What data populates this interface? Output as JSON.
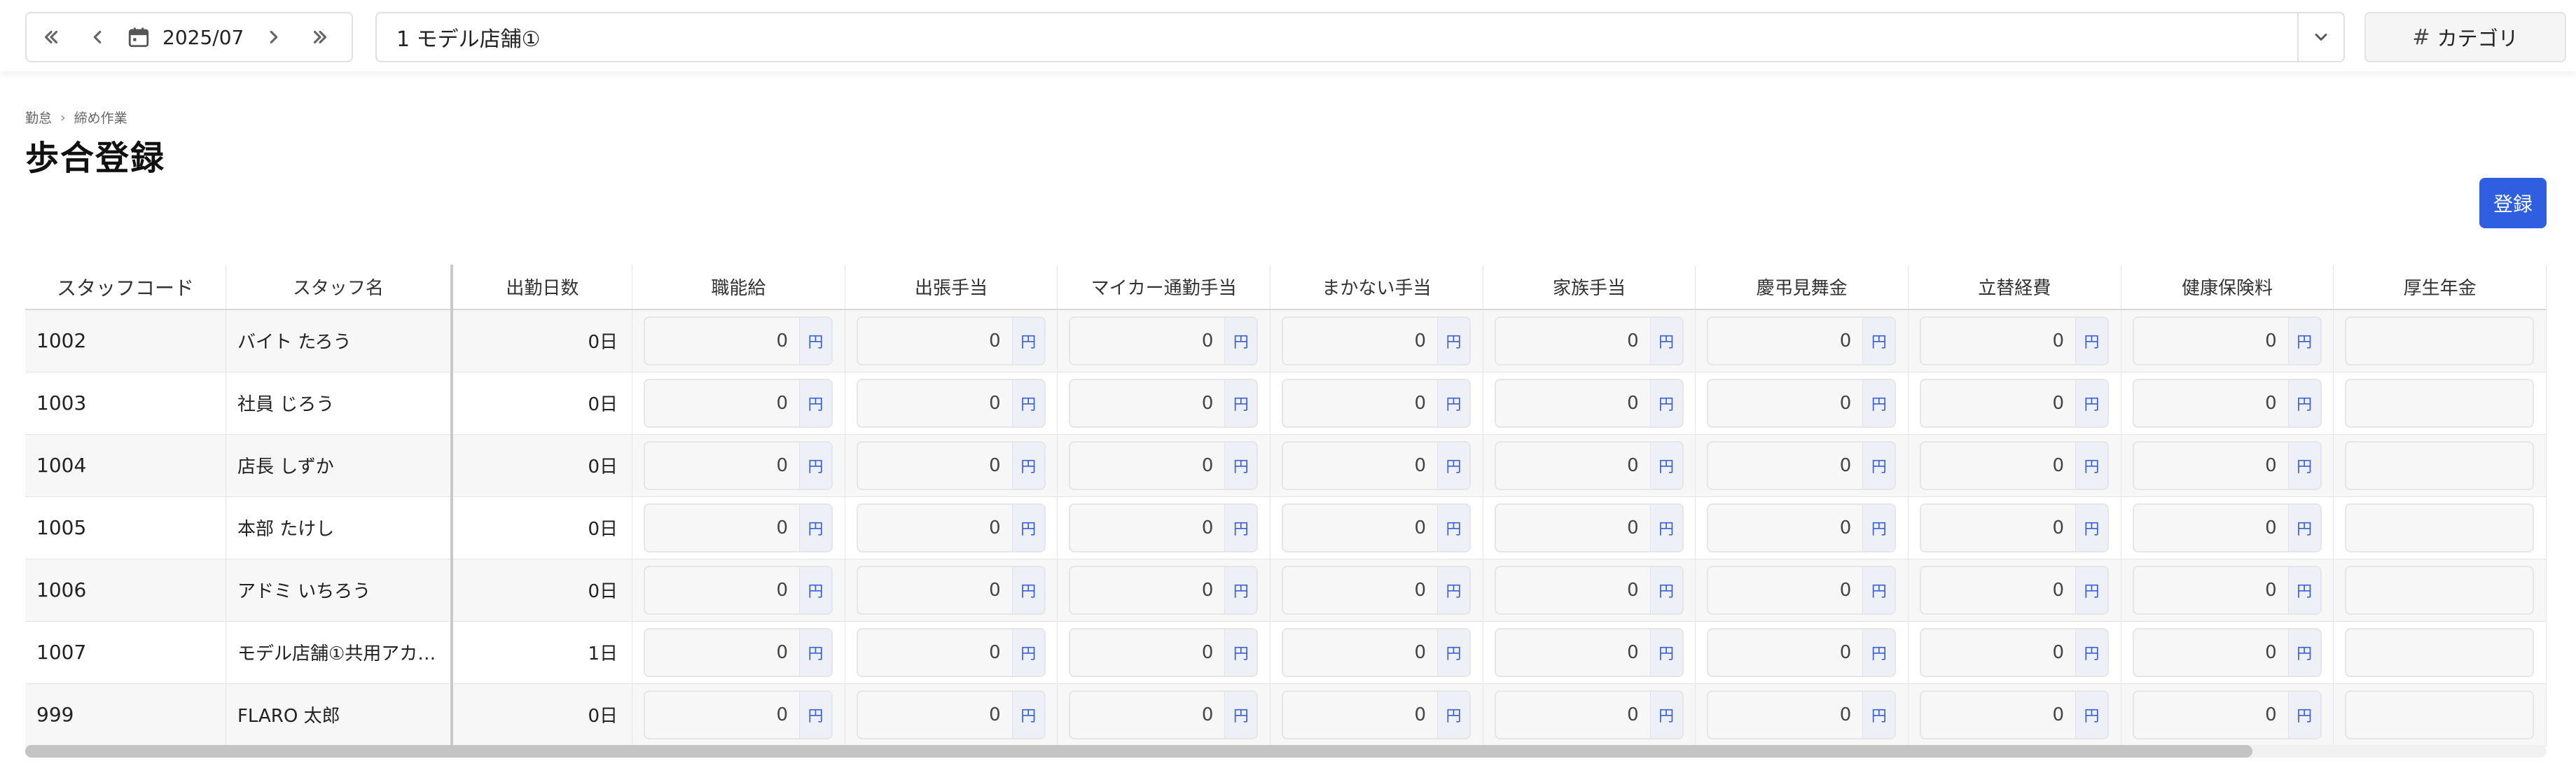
{
  "toolbar": {
    "month": "2025/07",
    "store": "1  モデル店舗①",
    "category_label": "カテゴリ",
    "category_symbol": "#"
  },
  "breadcrumb": [
    "勤怠",
    "締め作業"
  ],
  "page": {
    "title": "歩合登録",
    "register_label": "登録"
  },
  "table": {
    "headers": [
      "スタッフコード",
      "スタッフ名",
      "出勤日数",
      "職能給",
      "出張手当",
      "マイカー通勤手当",
      "まかない手当",
      "家族手当",
      "慶弔見舞金",
      "立替経費",
      "健康保険料",
      "厚生年金"
    ],
    "unit": "円",
    "rows": [
      {
        "code": "1002",
        "name": "バイト たろう",
        "days": "0日",
        "amounts": [
          "0",
          "0",
          "0",
          "0",
          "0",
          "0",
          "0",
          "0"
        ]
      },
      {
        "code": "1003",
        "name": "社員 じろう",
        "days": "0日",
        "amounts": [
          "0",
          "0",
          "0",
          "0",
          "0",
          "0",
          "0",
          "0"
        ]
      },
      {
        "code": "1004",
        "name": "店長 しずか",
        "days": "0日",
        "amounts": [
          "0",
          "0",
          "0",
          "0",
          "0",
          "0",
          "0",
          "0"
        ]
      },
      {
        "code": "1005",
        "name": "本部 たけし",
        "days": "0日",
        "amounts": [
          "0",
          "0",
          "0",
          "0",
          "0",
          "0",
          "0",
          "0"
        ]
      },
      {
        "code": "1006",
        "name": "アドミ いちろう",
        "days": "0日",
        "amounts": [
          "0",
          "0",
          "0",
          "0",
          "0",
          "0",
          "0",
          "0"
        ]
      },
      {
        "code": "1007",
        "name": "モデル店舗①共用アカ…",
        "days": "1日",
        "amounts": [
          "0",
          "0",
          "0",
          "0",
          "0",
          "0",
          "0",
          "0"
        ]
      },
      {
        "code": "999",
        "name": "FLARO 太郎",
        "days": "0日",
        "amounts": [
          "0",
          "0",
          "0",
          "0",
          "0",
          "0",
          "0",
          "0"
        ]
      }
    ]
  },
  "colors": {
    "accent": "#2f5fe0",
    "unit_text": "#3a5fd0"
  }
}
